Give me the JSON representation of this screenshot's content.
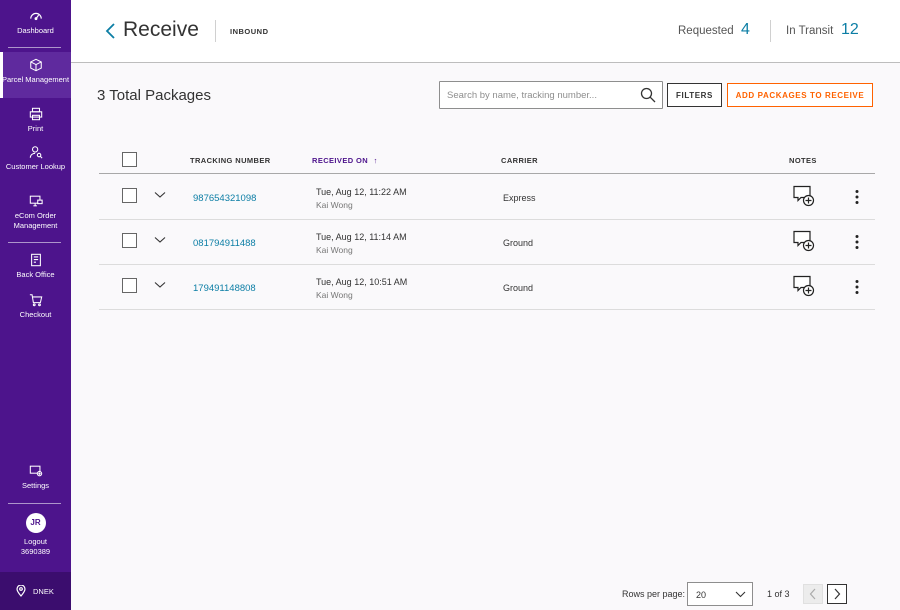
{
  "sidebar": {
    "items": [
      {
        "label": "Dashboard",
        "icon": "dashboard-icon"
      },
      {
        "label": "Parcel Management",
        "icon": "parcel-icon"
      },
      {
        "label": "Print",
        "icon": "printer-icon"
      },
      {
        "label": "Customer Lookup",
        "icon": "customer-icon"
      },
      {
        "label": "eCom Order Management",
        "icon": "ecom-icon"
      },
      {
        "label": "Back Office",
        "icon": "back-office-icon"
      },
      {
        "label": "Checkout",
        "icon": "cart-icon"
      },
      {
        "label": "Settings",
        "icon": "settings-icon"
      }
    ],
    "user": {
      "initials": "JR",
      "logout_label": "Logout",
      "user_id": "3690389"
    },
    "location": "DNEK",
    "colors": {
      "bg": "#4d148c",
      "active": "#5f2a9e",
      "location_bg": "#3b0d6e"
    }
  },
  "header": {
    "title": "Receive",
    "subtitle": "INBOUND",
    "stats": [
      {
        "label": "Requested",
        "value": "4"
      },
      {
        "label": "In Transit",
        "value": "12"
      }
    ]
  },
  "toolbar": {
    "total_count": "3",
    "total_label": "Total Packages",
    "search_placeholder": "Search by name, tracking number...",
    "filters_label": "FILTERS",
    "add_label": "ADD PACKAGES TO RECEIVE"
  },
  "table": {
    "columns": {
      "tracking": "TRACKING NUMBER",
      "received": "RECEIVED ON",
      "received_sort_glyph": "↑",
      "carrier": "CARRIER",
      "notes": "NOTES"
    },
    "rows": [
      {
        "tracking": "987654321098",
        "date": "Tue, Aug 12, 11:22 AM",
        "user": "Kai Wong",
        "carrier": "Express"
      },
      {
        "tracking": "081794911488",
        "date": "Tue, Aug 12, 11:14 AM",
        "user": "Kai Wong",
        "carrier": "Ground"
      },
      {
        "tracking": "179491148808",
        "date": "Tue, Aug 12, 10:51 AM",
        "user": "Kai Wong",
        "carrier": "Ground"
      }
    ]
  },
  "pagination": {
    "rows_label": "Rows per page:",
    "rows_value": "20",
    "page_info": "1 of 3"
  },
  "colors": {
    "accent": "#0c7ea5",
    "orange": "#ff6200",
    "purple": "#4d148c"
  }
}
